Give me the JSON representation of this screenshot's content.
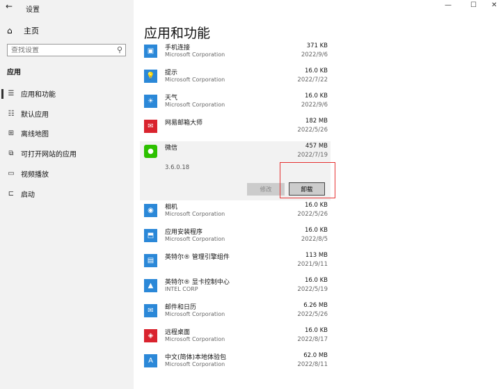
{
  "window": {
    "back_glyph": "←",
    "title": "设置",
    "controls": {
      "minimize": "—",
      "maximize": "☐",
      "close": "✕"
    }
  },
  "sidebar": {
    "home_label": "主页",
    "search_placeholder": "查找设置",
    "section_title": "应用",
    "items": [
      {
        "label": "应用和功能",
        "icon": "apps-list-icon",
        "glyph": "☰",
        "active": true
      },
      {
        "label": "默认应用",
        "icon": "default-apps-icon",
        "glyph": "☷",
        "active": false
      },
      {
        "label": "离线地图",
        "icon": "map-icon",
        "glyph": "⊞",
        "active": false
      },
      {
        "label": "可打开网站的应用",
        "icon": "open-website-icon",
        "glyph": "⧉",
        "active": false
      },
      {
        "label": "视频播放",
        "icon": "video-icon",
        "glyph": "▭",
        "active": false
      },
      {
        "label": "启动",
        "icon": "startup-icon",
        "glyph": "⊏",
        "active": false
      }
    ]
  },
  "main": {
    "page_title": "应用和功能",
    "apps_before": [
      {
        "name": "手机连接",
        "publisher": "Microsoft Corporation",
        "size": "371 KB",
        "date": "2022/9/6",
        "icon": "phone-link-icon",
        "color": "#2b88d8",
        "glyph": "▣"
      },
      {
        "name": "提示",
        "publisher": "Microsoft Corporation",
        "size": "16.0 KB",
        "date": "2022/7/22",
        "icon": "tips-icon",
        "color": "#2b88d8",
        "glyph": "💡"
      },
      {
        "name": "天气",
        "publisher": "Microsoft Corporation",
        "size": "16.0 KB",
        "date": "2022/9/6",
        "icon": "weather-icon",
        "color": "#2b88d8",
        "glyph": "☀"
      },
      {
        "name": "网易邮箱大师",
        "publisher": "",
        "size": "182 MB",
        "date": "2022/5/26",
        "icon": "netease-mail-icon",
        "color": "#d9232e",
        "glyph": "✉"
      }
    ],
    "expanded_app": {
      "name": "微信",
      "size": "457 MB",
      "date": "2022/7/19",
      "version": "3.6.0.18",
      "icon": "wechat-icon",
      "color": "#2dc100",
      "glyph": "●",
      "modify_label": "修改",
      "uninstall_label": "卸载"
    },
    "apps_after": [
      {
        "name": "相机",
        "publisher": "Microsoft Corporation",
        "size": "16.0 KB",
        "date": "2022/5/26",
        "icon": "camera-icon",
        "color": "#2b88d8",
        "glyph": "◉"
      },
      {
        "name": "应用安装程序",
        "publisher": "Microsoft Corporation",
        "size": "16.0 KB",
        "date": "2022/8/5",
        "icon": "app-installer-icon",
        "color": "#2b88d8",
        "glyph": "⬒"
      },
      {
        "name": "英特尔® 管理引擎组件",
        "publisher": "",
        "size": "113 MB",
        "date": "2021/9/11",
        "icon": "intel-me-icon",
        "color": "#2b88d8",
        "glyph": "▤"
      },
      {
        "name": "英特尔® 显卡控制中心",
        "publisher": "INTEL CORP",
        "size": "16.0 KB",
        "date": "2022/5/19",
        "icon": "intel-graphics-icon",
        "color": "#2b88d8",
        "glyph": "▲"
      },
      {
        "name": "邮件和日历",
        "publisher": "Microsoft Corporation",
        "size": "6.26 MB",
        "date": "2022/5/26",
        "icon": "mail-calendar-icon",
        "color": "#2b88d8",
        "glyph": "✉"
      },
      {
        "name": "远程桌面",
        "publisher": "Microsoft Corporation",
        "size": "16.0 KB",
        "date": "2022/8/17",
        "icon": "remote-desktop-icon",
        "color": "#d9232e",
        "glyph": "◈"
      },
      {
        "name": "中文(简体)本地体验包",
        "publisher": "Microsoft Corporation",
        "size": "62.0 MB",
        "date": "2022/8/11",
        "icon": "language-pack-icon",
        "color": "#2b88d8",
        "glyph": "A"
      }
    ]
  }
}
